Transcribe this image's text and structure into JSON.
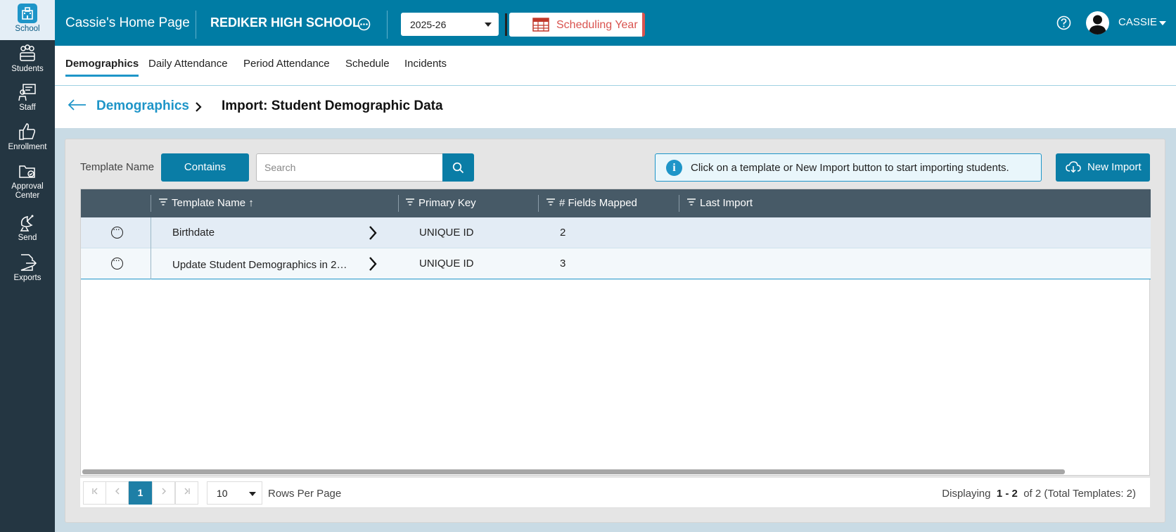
{
  "sidebar": {
    "items": [
      {
        "label": "School",
        "icon": "school-icon",
        "active": true
      },
      {
        "label": "Students",
        "icon": "students-icon"
      },
      {
        "label": "Staff",
        "icon": "staff-icon"
      },
      {
        "label": "Enrollment",
        "icon": "thumbs-up-icon"
      },
      {
        "label_line1": "Approval",
        "label_line2": "Center",
        "icon": "folder-icon"
      },
      {
        "label": "Send",
        "icon": "satellite-icon"
      },
      {
        "label": "Exports",
        "icon": "export-icon"
      }
    ]
  },
  "topbar": {
    "home_title": "Cassie's Home Page",
    "school_name": "REDIKER HIGH SCHOOL",
    "year": "2025-26",
    "scheduling_label": "Scheduling Year",
    "user_name": "CASSIE",
    "accent_color": "#007ca4",
    "scheduling_color": "#d9534f"
  },
  "subnav": {
    "tabs": [
      "Demographics",
      "Daily Attendance",
      "Period Attendance",
      "Schedule",
      "Incidents"
    ],
    "active": "Demographics"
  },
  "breadcrumb": {
    "parent": "Demographics",
    "current": "Import: Student Demographic Data"
  },
  "toolbar": {
    "filter_label": "Template Name",
    "contains_label": "Contains",
    "search_placeholder": "Search",
    "info_text": "Click on a template or New Import button to start importing students.",
    "new_import_label": "New Import"
  },
  "grid": {
    "columns": [
      "Template Name ↑",
      "Primary Key",
      "# Fields Mapped",
      "Last Import"
    ],
    "rows": [
      {
        "name": "Birthdate",
        "primary_key": "UNIQUE ID",
        "fields_mapped": "2",
        "last_import": ""
      },
      {
        "name": "Update Student Demographics in 2…",
        "primary_key": "UNIQUE ID",
        "fields_mapped": "3",
        "last_import": ""
      }
    ]
  },
  "pager": {
    "current_page": "1",
    "rows_per_page": "10",
    "rows_per_page_label": "Rows Per Page",
    "displaying_prefix": "Displaying",
    "displaying_range": "1 - 2",
    "displaying_of": "of",
    "displaying_suffix": "2 (Total Templates: 2)"
  }
}
